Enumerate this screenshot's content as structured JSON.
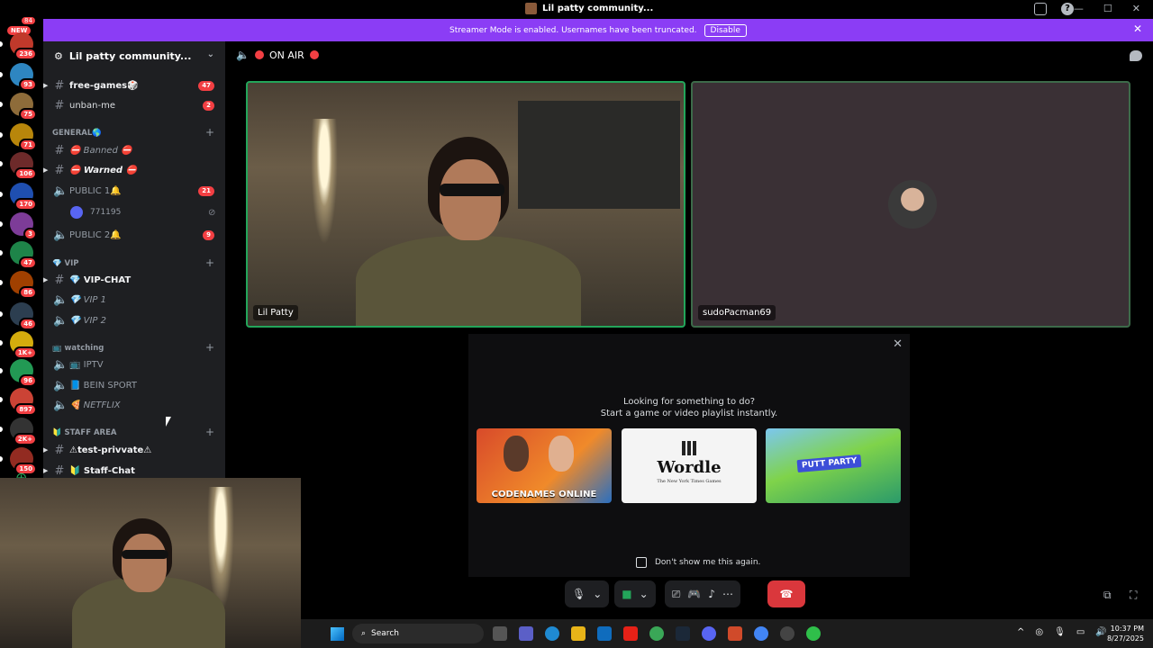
{
  "window": {
    "title": "Lil patty community..."
  },
  "banner": {
    "text": "Streamer Mode is enabled. Usernames have been truncated.",
    "button": "Disable"
  },
  "servers": [
    {
      "badge": "NEW",
      "color": "#5865f2"
    },
    {
      "badge": "236",
      "color": "#c0392b"
    },
    {
      "badge": "93",
      "color": "#2e86c1"
    },
    {
      "badge": "75",
      "color": "#8e6c3a"
    },
    {
      "badge": "71",
      "color": "#b8860b"
    },
    {
      "badge": "106",
      "color": "#6d2a2a"
    },
    {
      "badge": "170",
      "color": "#1f4fb0"
    },
    {
      "badge": "3",
      "color": "#7d3c98"
    },
    {
      "badge": "47",
      "color": "#1e8449"
    },
    {
      "badge": "86",
      "color": "#a04000"
    },
    {
      "badge": "46",
      "color": "#2c3e50"
    },
    {
      "badge": "1K+",
      "color": "#d4ac0d"
    },
    {
      "badge": "96",
      "color": "#229954"
    },
    {
      "badge": "897",
      "color": "#cb4335"
    },
    {
      "badge": "2K+",
      "color": "#333333"
    },
    {
      "badge": "150",
      "color": "#922b21"
    }
  ],
  "server_top_count": "84",
  "sidebar": {
    "guild_name": "Lil patty community...",
    "channels": [
      {
        "type": "text",
        "name": "free-games🎲",
        "unread": true,
        "count": "47"
      },
      {
        "type": "text",
        "name": "unban-me",
        "unread": false,
        "count": "2"
      }
    ],
    "cat_general": "GENERAL🌎",
    "general": [
      {
        "type": "text",
        "name": "⛔ Banned ⛔",
        "italic": true
      },
      {
        "type": "text",
        "name": "⛔ Warned ⛔",
        "italic": true,
        "unread": true
      },
      {
        "type": "voice",
        "name": "PUBLIC 1🔔",
        "count": "21"
      },
      {
        "type": "voice",
        "name": "PUBLIC 2🔔",
        "count": "9"
      }
    ],
    "voice_user": "771195",
    "cat_vip": "💎 VIP",
    "vip": [
      {
        "type": "text",
        "name": "💎 VIP-CHAT",
        "unread": true
      },
      {
        "type": "voice",
        "name": "💎 VIP 1",
        "italic": true
      },
      {
        "type": "voice",
        "name": "💎 VIP 2",
        "italic": true
      }
    ],
    "cat_watching": "📺 watching",
    "watching": [
      {
        "type": "voice",
        "name": "📺 IPTV"
      },
      {
        "type": "voice",
        "name": "📘 BEIN SPORT"
      },
      {
        "type": "voice",
        "name": "🍕 NETFLIX",
        "italic": true
      }
    ],
    "cat_staff": "🔰 STAFF AREA",
    "staff": [
      {
        "type": "text",
        "name": "⚠test-privvate⚠",
        "unread": true
      },
      {
        "type": "text",
        "name": "🔰 Staff-Chat",
        "unread": true
      }
    ]
  },
  "stage": {
    "header": "ON AIR",
    "tile1_name": "Lil Patty",
    "tile2_name": "sudoPacman69"
  },
  "activities": {
    "line1": "Looking for something to do?",
    "line2": "Start a game or video playlist instantly.",
    "games": [
      "CODENAMES ONLINE",
      "Wordle",
      "PUTT PARTY"
    ],
    "wordle_sub": "The New York Times Games",
    "dont_show": "Don't show me this again."
  },
  "taskbar": {
    "search": "Search",
    "time": "10:37 PM",
    "date": "8/27/2025"
  },
  "colors": {
    "accent": "#8b3df5",
    "green": "#23a55a",
    "red": "#f23f43"
  }
}
